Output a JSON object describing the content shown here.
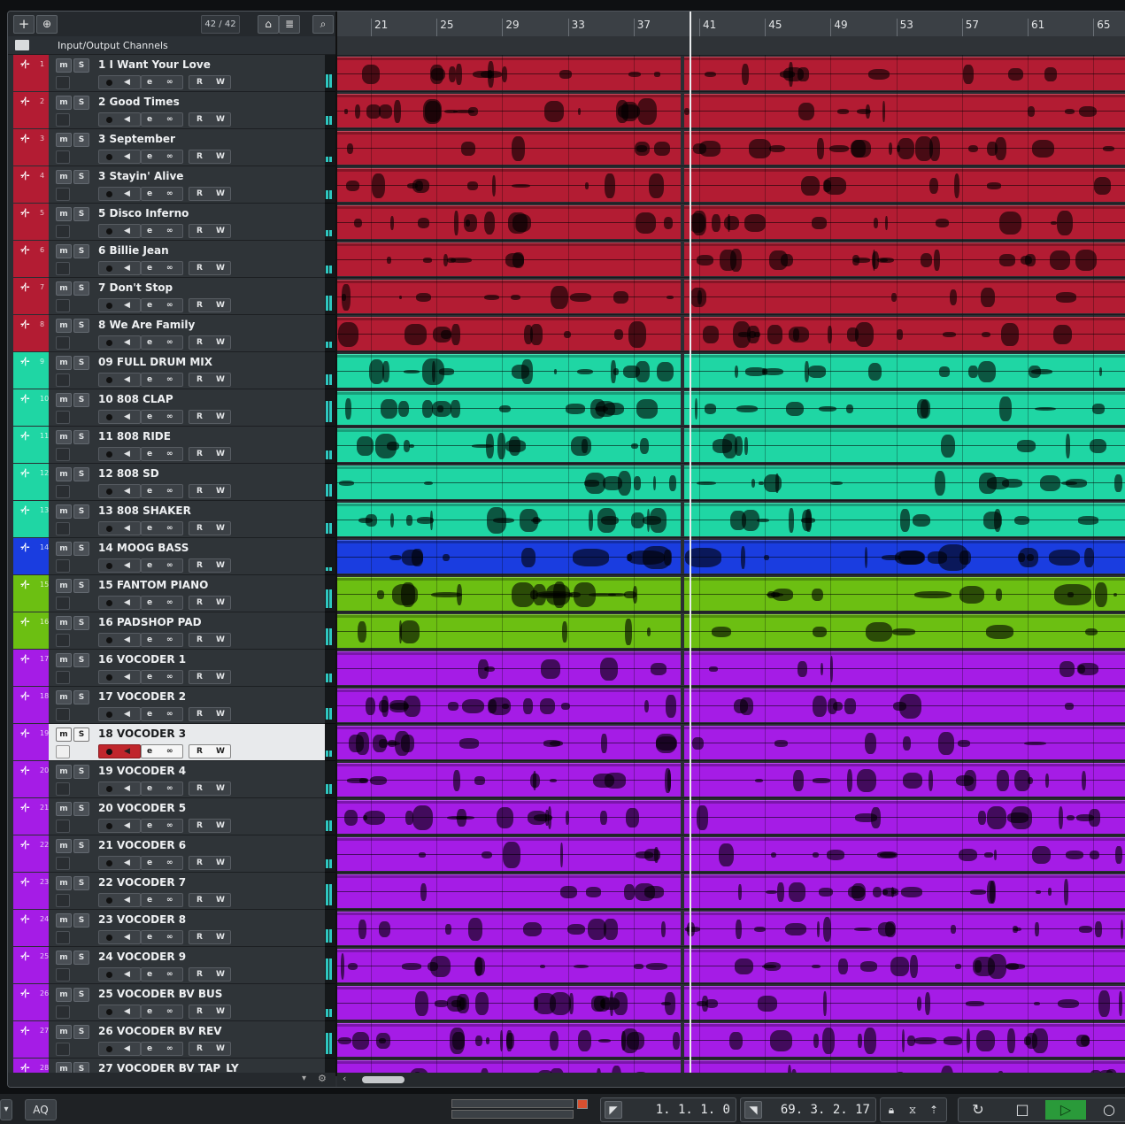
{
  "toolbar": {
    "add_icon": "plus-icon",
    "add_folder_icon": "add-track-folder-icon",
    "count": "42 / 42",
    "view_icon": "home-icon",
    "list_icon": "list-icon",
    "search_icon": "search-icon"
  },
  "io_label": "Input/Output Channels",
  "ruler": {
    "bars": [
      "21",
      "25",
      "29",
      "33",
      "37",
      "41",
      "45",
      "49",
      "53",
      "57",
      "61",
      "65"
    ]
  },
  "track_buttons": {
    "mute": "m",
    "solo": "S",
    "read": "R",
    "write": "W"
  },
  "tracks": [
    {
      "num": "1",
      "name": "1 I Want Your Love",
      "color": "#b31c33"
    },
    {
      "num": "2",
      "name": "2 Good Times",
      "color": "#b31c33"
    },
    {
      "num": "3",
      "name": "3 September",
      "color": "#b31c33"
    },
    {
      "num": "4",
      "name": "3 Stayin' Alive",
      "color": "#b31c33"
    },
    {
      "num": "5",
      "name": "5 Disco Inferno",
      "color": "#b31c33"
    },
    {
      "num": "6",
      "name": "6 Billie Jean",
      "color": "#b31c33"
    },
    {
      "num": "7",
      "name": "7 Don't Stop",
      "color": "#b31c33"
    },
    {
      "num": "8",
      "name": "8 We Are Family",
      "color": "#b31c33"
    },
    {
      "num": "9",
      "name": "09 FULL DRUM MIX",
      "color": "#1fd6a4"
    },
    {
      "num": "10",
      "name": "10 808 CLAP",
      "color": "#1fd6a4"
    },
    {
      "num": "11",
      "name": "11 808 RIDE",
      "color": "#1fd6a4"
    },
    {
      "num": "12",
      "name": "12 808 SD",
      "color": "#1fd6a4"
    },
    {
      "num": "13",
      "name": "13  808 SHAKER",
      "color": "#1fd6a4"
    },
    {
      "num": "14",
      "name": "14 MOOG BASS",
      "color": "#1a3de0"
    },
    {
      "num": "15",
      "name": "15 FANTOM PIANO",
      "color": "#6cbf12"
    },
    {
      "num": "16",
      "name": "16 PADSHOP PAD",
      "color": "#6cbf12"
    },
    {
      "num": "17",
      "name": "16 VOCODER  1",
      "color": "#a51ce6"
    },
    {
      "num": "18",
      "name": "17 VOCODER  2",
      "color": "#a51ce6"
    },
    {
      "num": "19",
      "name": "18 VOCODER 3",
      "color": "#a51ce6",
      "selected": true
    },
    {
      "num": "20",
      "name": "19 VOCODER 4",
      "color": "#a51ce6"
    },
    {
      "num": "21",
      "name": "20 VOCODER 5",
      "color": "#a51ce6"
    },
    {
      "num": "22",
      "name": "21 VOCODER 6",
      "color": "#a51ce6"
    },
    {
      "num": "23",
      "name": "22 VOCODER 7",
      "color": "#a51ce6"
    },
    {
      "num": "24",
      "name": "23 VOCODER 8",
      "color": "#a51ce6"
    },
    {
      "num": "25",
      "name": "24 VOCODER 9",
      "color": "#a51ce6"
    },
    {
      "num": "26",
      "name": "25 VOCODER BV BUS",
      "color": "#a51ce6"
    },
    {
      "num": "27",
      "name": "26 VOCODER BV REV",
      "color": "#a51ce6"
    },
    {
      "num": "28",
      "name": "27 VOCODER BV TAP_LY",
      "color": "#a51ce6"
    }
  ],
  "transport": {
    "aq": "AQ",
    "left_locator": "1.  1.  1.    0",
    "right_locator": "69.  3.  2.  17",
    "cycle_icon": "cycle-icon",
    "stop_icon": "stop-icon",
    "play_icon": "play-icon",
    "record_icon": "record-icon"
  }
}
